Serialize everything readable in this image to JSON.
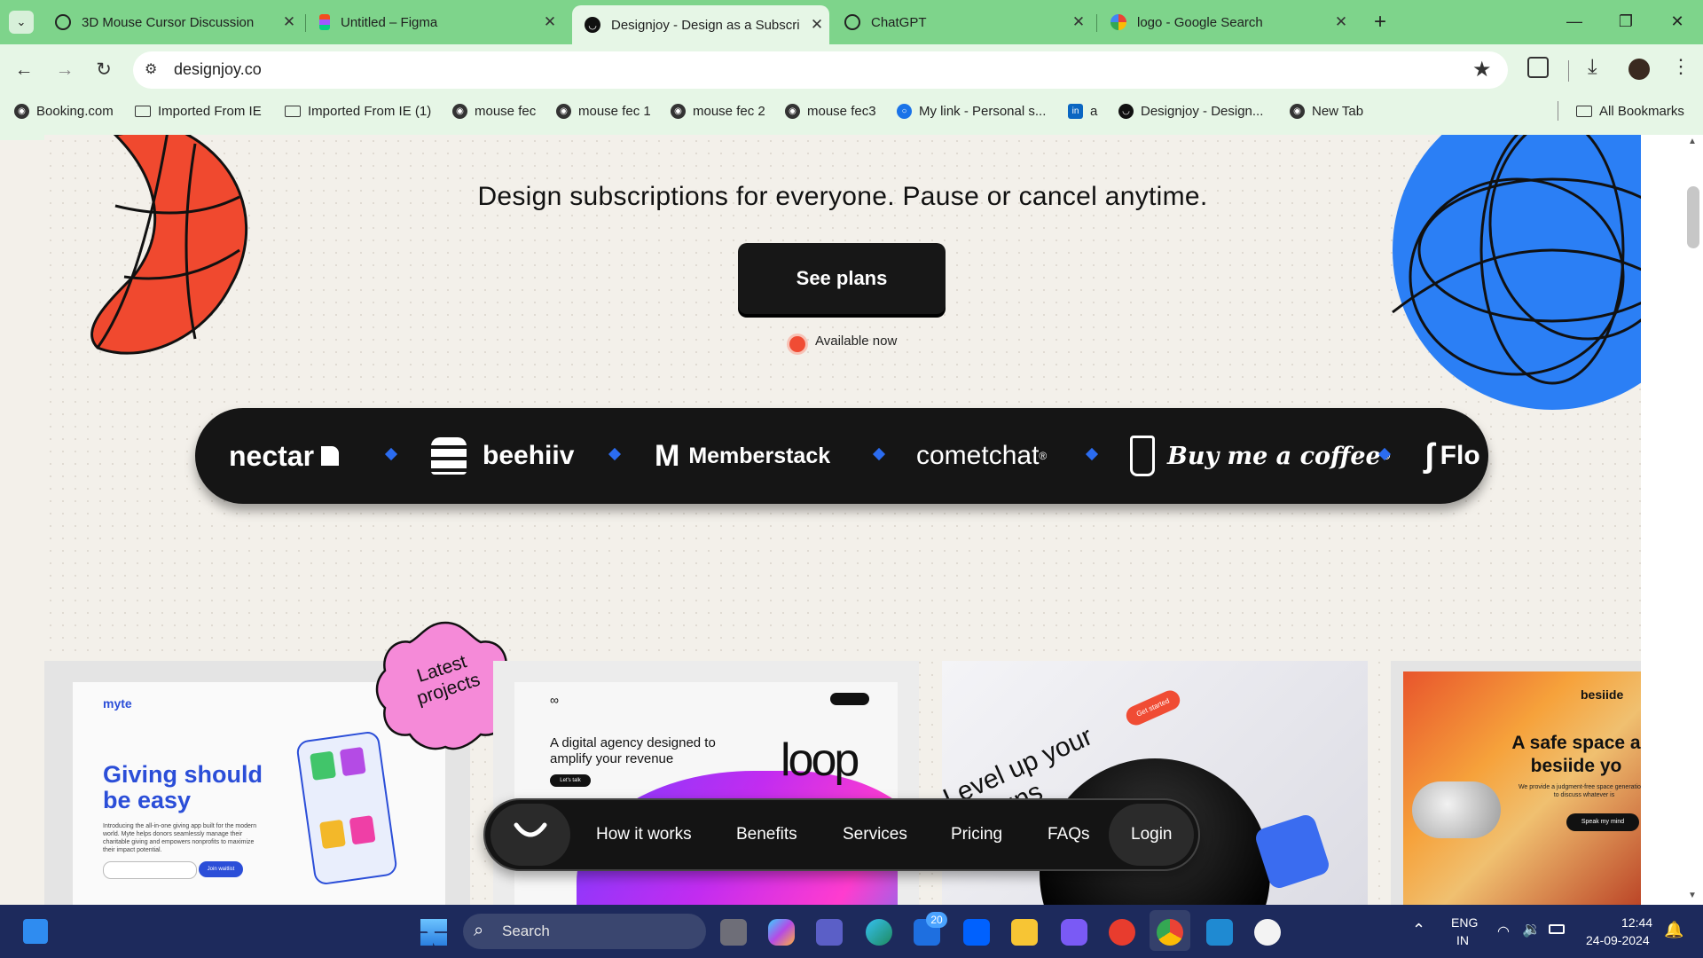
{
  "browser": {
    "tabs": [
      {
        "label": "3D Mouse Cursor Discussion",
        "icon": "chatgpt-icon"
      },
      {
        "label": "Untitled – Figma",
        "icon": "figma-icon"
      },
      {
        "label": "Designjoy - Design as a Subscri",
        "icon": "designjoy-icon",
        "active": true
      },
      {
        "label": "ChatGPT",
        "icon": "chatgpt-icon"
      },
      {
        "label": "logo - Google Search",
        "icon": "google-icon"
      }
    ],
    "url": "designjoy.co",
    "bookmarks": [
      {
        "label": "Booking.com",
        "icon": "globe-icon"
      },
      {
        "label": "Imported From IE",
        "icon": "folder-icon"
      },
      {
        "label": "Imported From IE (1)",
        "icon": "folder-icon"
      },
      {
        "label": "mouse fec",
        "icon": "globe-icon"
      },
      {
        "label": "mouse fec 1",
        "icon": "globe-icon"
      },
      {
        "label": "mouse fec 2",
        "icon": "globe-icon"
      },
      {
        "label": "mouse fec3",
        "icon": "globe-icon"
      },
      {
        "label": "My link - Personal s...",
        "icon": "link-icon"
      },
      {
        "label": "a",
        "icon": "linkedin-icon"
      },
      {
        "label": "Designjoy - Design...",
        "icon": "designjoy-icon"
      },
      {
        "label": "New Tab",
        "icon": "globe-icon"
      }
    ],
    "all_bookmarks": "All Bookmarks"
  },
  "page": {
    "headline": "Design subscriptions for everyone. Pause or cancel anytime.",
    "cta": "See plans",
    "availability": "Available now",
    "logos": [
      "nectar",
      "beehiiv",
      "Memberstack",
      "cometchat",
      "Buy me a coffee",
      "Flo"
    ],
    "badge": "Latest projects",
    "cards": [
      {
        "brand": "myte",
        "title": "Giving should be easy",
        "body": "Introducing the all-in-one giving app built for the modern world. Myte helps donors seamlessly manage their charitable giving and empowers nonprofits to maximize their impact potential.",
        "cta": "Join waitlist"
      },
      {
        "brand": "loop",
        "title": "A digital agency designed to amplify your revenue",
        "cta": "Let's talk"
      },
      {
        "title": "Level up your designs",
        "cta": "Get started"
      },
      {
        "brand": "besiide",
        "title": "A safe space a besiide yo",
        "body": "We provide a judgment-free space generation Z to discuss whatever is",
        "cta": "Speak my mind"
      }
    ],
    "nav": [
      "How it works",
      "Benefits",
      "Services",
      "Pricing",
      "FAQs",
      "Login"
    ]
  },
  "taskbar": {
    "search_placeholder": "Search",
    "mail_badge": "20",
    "lang": "ENG",
    "region": "IN",
    "time": "12:44",
    "date": "24-09-2024"
  },
  "colors": {
    "tabbar": "#7ed48b",
    "toolbar": "#e6f6e6",
    "page_bg": "#f3f0ea",
    "accent_red": "#f04c34",
    "accent_blue": "#2b7ff5",
    "taskbar": "#1d2a5c"
  }
}
